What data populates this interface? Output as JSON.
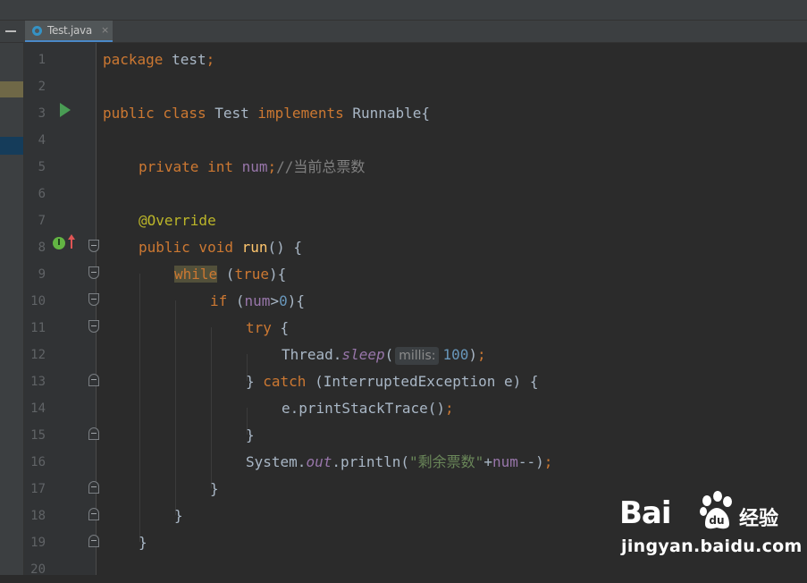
{
  "editor_tab": {
    "filename": "Test.java",
    "close": "×"
  },
  "line_numbers": [
    "1",
    "2",
    "3",
    "4",
    "5",
    "6",
    "7",
    "8",
    "9",
    "10",
    "11",
    "12",
    "13",
    "14",
    "15",
    "16",
    "17",
    "18",
    "19",
    "20"
  ],
  "code": {
    "l1_package": "package",
    "l1_name": " test",
    "l1_semi": ";",
    "l3_public": "public",
    "l3_class": " class",
    "l3_name": " Test",
    "l3_implements": " implements",
    "l3_iface": " Runnable{",
    "l5_private": "private",
    "l5_int": " int",
    "l5_field": " num",
    "l5_semi": ";",
    "l5_comment": "//当前总票数",
    "l7_annotation": "@Override",
    "l8_public": "public",
    "l8_void": " void",
    "l8_method": " run",
    "l8_rest": "() {",
    "l9_while": "while",
    "l9_rest": " (",
    "l9_true": "true",
    "l9_end": "){",
    "l10_if": "if",
    "l10_open": " (",
    "l10_field": "num",
    "l10_op": ">",
    "l10_num": "0",
    "l10_end": "){",
    "l11_try": "try",
    "l11_brace": " {",
    "l12_class": "Thread.",
    "l12_method": "sleep",
    "l12_paren": "(",
    "l12_hint": "millis:",
    "l12_num": "100",
    "l12_close": ")",
    "l12_semi": ";",
    "l13_close": "}",
    "l13_catch": " catch",
    "l13_rest": " (InterruptedException e) {",
    "l14_call": "e.printStackTrace()",
    "l14_semi": ";",
    "l15_close": "}",
    "l16_class": "System.",
    "l16_out": "out",
    "l16_dot": ".println(",
    "l16_str": "\"剩余票数\"",
    "l16_plus": "+",
    "l16_field": "num",
    "l16_dec": "--)",
    "l16_semi": ";",
    "l17_close": "}",
    "l18_close": "}",
    "l19_close": "}"
  },
  "watermark": {
    "brand": "Bai",
    "suffix": "经验",
    "url": "jingyan.baidu.com"
  },
  "colors": {
    "keyword": "#cc7832",
    "field": "#9876aa",
    "comment": "#808080",
    "annotation": "#bbb529",
    "method": "#ffc66d",
    "number": "#6897bb",
    "string": "#6a8759",
    "text": "#a9b7c6",
    "background": "#2b2b2b"
  },
  "icons": [
    "run-gutter-icon",
    "implements-gutter-icon",
    "override-arrow-icon",
    "fold-marker-icon",
    "java-class-file-icon",
    "close-tab-icon",
    "minimize-icon",
    "baidu-paw-icon"
  ]
}
